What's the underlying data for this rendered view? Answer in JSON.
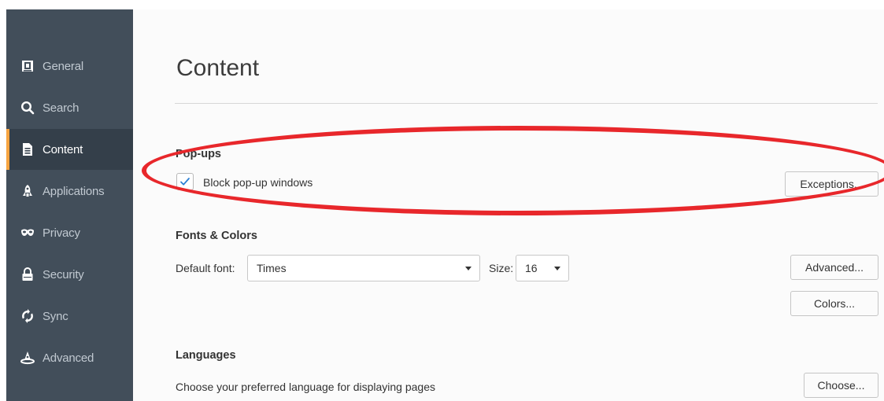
{
  "sidebar": {
    "items": [
      {
        "label": "General",
        "icon": "general-icon"
      },
      {
        "label": "Search",
        "icon": "search-icon"
      },
      {
        "label": "Content",
        "icon": "document-icon",
        "active": true
      },
      {
        "label": "Applications",
        "icon": "rocket-icon"
      },
      {
        "label": "Privacy",
        "icon": "mask-icon"
      },
      {
        "label": "Security",
        "icon": "lock-icon"
      },
      {
        "label": "Sync",
        "icon": "sync-icon"
      },
      {
        "label": "Advanced",
        "icon": "wizard-hat-icon"
      }
    ]
  },
  "main": {
    "title": "Content",
    "popups": {
      "heading": "Pop-ups",
      "block_label": "Block pop-up windows",
      "block_checked": true,
      "exceptions_button": "Exceptions..."
    },
    "fonts": {
      "heading": "Fonts & Colors",
      "default_font_label": "Default font:",
      "default_font_value": "Times",
      "size_label": "Size:",
      "size_value": "16",
      "advanced_button": "Advanced...",
      "colors_button": "Colors..."
    },
    "languages": {
      "heading": "Languages",
      "description": "Choose your preferred language for displaying pages",
      "choose_button": "Choose..."
    }
  },
  "colors": {
    "sidebar_bg": "#424e5a",
    "active_accent": "#f7a440",
    "highlight": "#e8272b",
    "check": "#2a7fd4"
  }
}
